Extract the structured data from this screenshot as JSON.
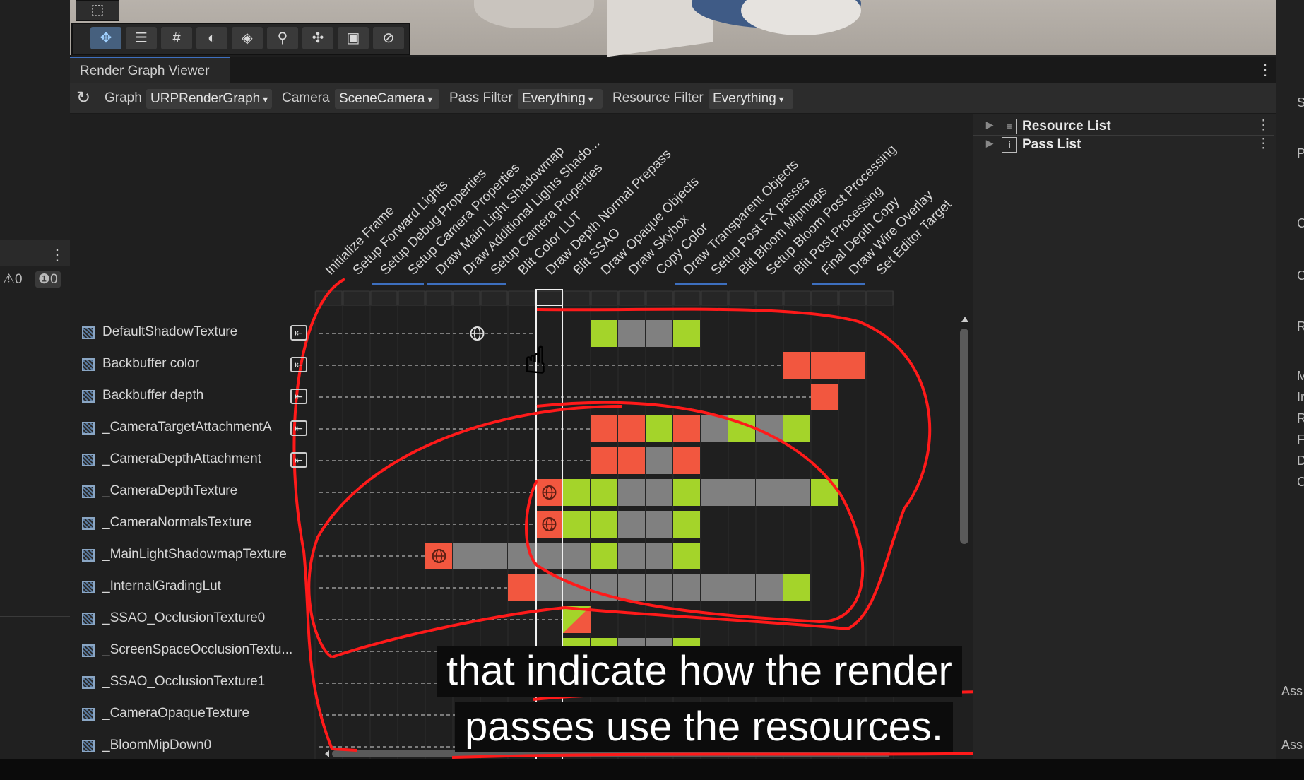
{
  "window": {
    "tab_title": "Render Graph Viewer"
  },
  "toolbar": {
    "rect_tool_icon": "rect-select-icon",
    "tools": [
      "move-icon",
      "sliders-icon",
      "grid-icon",
      "shading-icon",
      "layers-icon",
      "search-icon",
      "transform-icon",
      "camera-icon",
      "compass-icon"
    ]
  },
  "filter_bar": {
    "refresh_icon": "refresh-icon",
    "graph_label": "Graph",
    "graph_value": "URPRenderGraph",
    "camera_label": "Camera",
    "camera_value": "SceneCamera",
    "pass_filter_label": "Pass Filter",
    "pass_filter_value": "Everything",
    "resource_filter_label": "Resource Filter",
    "resource_filter_value": "Everything"
  },
  "console_counters": {
    "warnings": "0",
    "errors": "0"
  },
  "right_panel": {
    "items": [
      {
        "label": "Resource List",
        "icon": "list-icon"
      },
      {
        "label": "Pass List",
        "icon": "info-icon"
      }
    ]
  },
  "far_right_letters": [
    "S",
    "P",
    "C",
    "C",
    "R",
    "M",
    "Ir",
    "R",
    "F",
    "D",
    "C",
    "Ass",
    "Ass"
  ],
  "passes": [
    "Initialize Frame",
    "Setup Forward Lights",
    "Setup Debug Properties",
    "Setup Camera Properties",
    "Draw Main Light Shadowmap",
    "Draw Additional Lights Shado...",
    "Setup Camera Properties",
    "Blit Color LUT",
    "Draw Depth Normal Prepass",
    "Blit SSAO",
    "Draw Opaque Objects",
    "Draw Skybox",
    "Copy Color",
    "Draw Transparent Objects",
    "Setup Post FX passes",
    "Blit Bloom Mipmaps",
    "Setup Bloom Post Processing",
    "Blit Post Processing",
    "Final Depth Copy",
    "Draw Wire Overlay",
    "Set Editor Target"
  ],
  "resources": [
    {
      "name": "DefaultShadowTexture",
      "imported": true
    },
    {
      "name": "Backbuffer color",
      "imported": true
    },
    {
      "name": "Backbuffer depth",
      "imported": true
    },
    {
      "name": "_CameraTargetAttachmentA",
      "imported": true
    },
    {
      "name": "_CameraDepthAttachment",
      "imported": true
    },
    {
      "name": "_CameraDepthTexture",
      "imported": false
    },
    {
      "name": "_CameraNormalsTexture",
      "imported": false
    },
    {
      "name": "_MainLightShadowmapTexture",
      "imported": false
    },
    {
      "name": "_InternalGradingLut",
      "imported": false
    },
    {
      "name": "_SSAO_OcclusionTexture0",
      "imported": false
    },
    {
      "name": "_ScreenSpaceOcclusionTextu...",
      "imported": false
    },
    {
      "name": "_SSAO_OcclusionTexture1",
      "imported": false
    },
    {
      "name": "_CameraOpaqueTexture",
      "imported": false
    },
    {
      "name": "_BloomMipDown0",
      "imported": false
    }
  ],
  "grid": {
    "colors": {
      "write": "#f2573f",
      "read": "#a4d42a",
      "alive": "#808080",
      "accent": "#3d6fbf"
    },
    "rows": [
      {
        "dash_to": 8,
        "globe_col": 5,
        "cells": [
          [
            10,
            "read"
          ],
          [
            11,
            "alive"
          ],
          [
            12,
            "alive"
          ],
          [
            13,
            "read"
          ]
        ]
      },
      {
        "dash_to": 17,
        "cells": [
          [
            17,
            "write"
          ],
          [
            18,
            "write"
          ],
          [
            19,
            "write"
          ]
        ]
      },
      {
        "dash_to": 18,
        "cells": [
          [
            18,
            "write"
          ]
        ]
      },
      {
        "dash_to": 10,
        "cells": [
          [
            10,
            "write"
          ],
          [
            11,
            "write"
          ],
          [
            12,
            "read"
          ],
          [
            13,
            "write"
          ],
          [
            14,
            "alive"
          ],
          [
            15,
            "read"
          ],
          [
            16,
            "alive"
          ],
          [
            17,
            "read"
          ]
        ]
      },
      {
        "dash_to": 10,
        "cells": [
          [
            10,
            "write"
          ],
          [
            11,
            "write"
          ],
          [
            12,
            "alive"
          ],
          [
            13,
            "write"
          ]
        ]
      },
      {
        "dash_to": 8,
        "cells": [
          [
            8,
            "write-globe"
          ],
          [
            9,
            "read"
          ],
          [
            10,
            "read"
          ],
          [
            11,
            "alive"
          ],
          [
            12,
            "alive"
          ],
          [
            13,
            "read"
          ],
          [
            14,
            "alive"
          ],
          [
            15,
            "alive"
          ],
          [
            16,
            "alive"
          ],
          [
            17,
            "alive"
          ],
          [
            18,
            "read"
          ]
        ]
      },
      {
        "dash_to": 8,
        "cells": [
          [
            8,
            "write-globe"
          ],
          [
            9,
            "read"
          ],
          [
            10,
            "read"
          ],
          [
            11,
            "alive"
          ],
          [
            12,
            "alive"
          ],
          [
            13,
            "read"
          ]
        ]
      },
      {
        "dash_to": 4,
        "cells": [
          [
            4,
            "write-globe"
          ],
          [
            5,
            "alive"
          ],
          [
            6,
            "alive"
          ],
          [
            7,
            "alive"
          ],
          [
            8,
            "alive"
          ],
          [
            9,
            "alive"
          ],
          [
            10,
            "read"
          ],
          [
            11,
            "alive"
          ],
          [
            12,
            "alive"
          ],
          [
            13,
            "read"
          ]
        ]
      },
      {
        "dash_to": 7,
        "cells": [
          [
            7,
            "write"
          ],
          [
            8,
            "alive"
          ],
          [
            9,
            "alive"
          ],
          [
            10,
            "alive"
          ],
          [
            11,
            "alive"
          ],
          [
            12,
            "alive"
          ],
          [
            13,
            "alive"
          ],
          [
            14,
            "alive"
          ],
          [
            15,
            "alive"
          ],
          [
            16,
            "alive"
          ],
          [
            17,
            "read"
          ]
        ]
      },
      {
        "dash_to": 9,
        "cells": [
          [
            9,
            "split"
          ]
        ]
      },
      {
        "dash_to": 9,
        "cells": [
          [
            9,
            "read"
          ],
          [
            10,
            "read"
          ],
          [
            11,
            "alive"
          ],
          [
            12,
            "alive"
          ],
          [
            13,
            "read"
          ]
        ]
      },
      {
        "dash_to": 9,
        "cells": [
          [
            9,
            "read"
          ],
          [
            10,
            "alive"
          ],
          [
            11,
            "alive"
          ],
          [
            12,
            "alive"
          ],
          [
            13,
            "read"
          ]
        ]
      },
      {
        "dash_to": 12,
        "cells": [
          [
            12,
            "write"
          ]
        ]
      },
      {
        "dash_to": 14,
        "cells": []
      }
    ],
    "pass_bars": [
      [
        2,
        3
      ],
      [
        4,
        6
      ],
      [
        13,
        14
      ],
      [
        18,
        19
      ]
    ]
  },
  "subtitle": {
    "line1": "that indicate how the render",
    "line2": "passes use the resources."
  }
}
